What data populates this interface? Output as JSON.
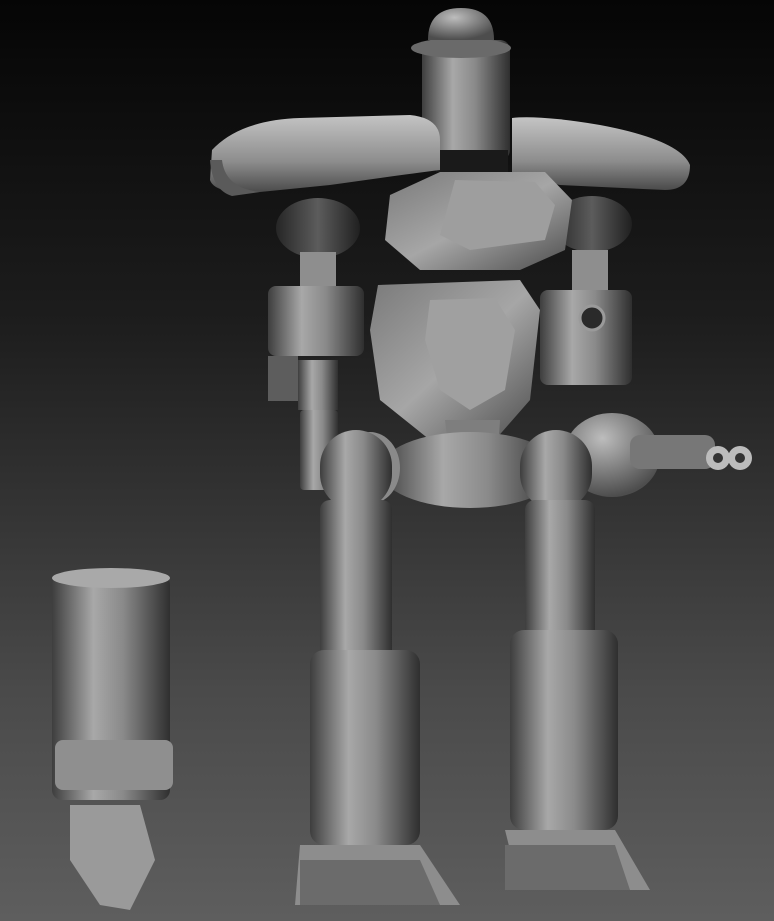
{
  "scene": {
    "description_colors": {
      "background_top": "#050505",
      "background_bottom": "#5e5e5e",
      "material_light": "#c9c9c9",
      "material_mid": "#8c8c8c",
      "material_dark": "#3a3a3a"
    },
    "objects": [
      "robot-mech",
      "detached-arm-part"
    ]
  }
}
